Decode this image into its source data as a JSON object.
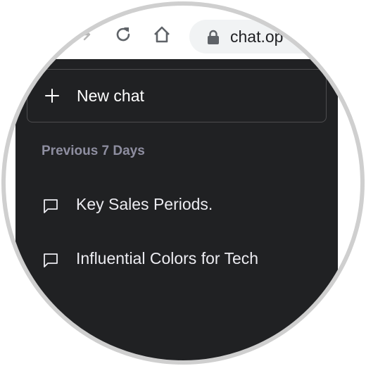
{
  "browser": {
    "url_text": "chat.op",
    "icons": [
      "forward-arrow",
      "reload",
      "home",
      "lock"
    ]
  },
  "sidebar": {
    "new_chat_label": "New chat",
    "section_heading": "Previous 7 Days",
    "chats": [
      {
        "label": "Key Sales Periods."
      },
      {
        "label": "Influential Colors for Tech"
      }
    ]
  },
  "colors": {
    "sidebar_bg": "#202123",
    "heading_text": "#8e8ea0",
    "border": "#4d4d4f"
  }
}
